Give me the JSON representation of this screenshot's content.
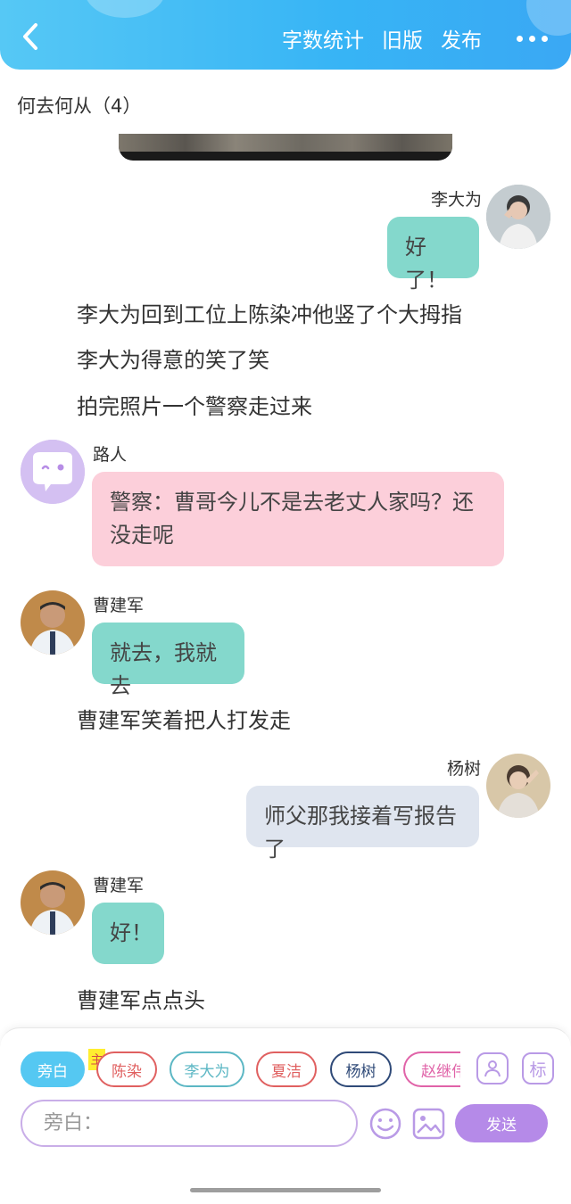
{
  "header": {
    "word_count": "字数统计",
    "old_version": "旧版",
    "publish": "发布",
    "back_icon": "chevron-left-icon",
    "more_icon": "more-dots-icon"
  },
  "chapter_title": "何去何从（4）",
  "messages": {
    "m1": {
      "name": "李大为",
      "text": "好了！"
    },
    "n1": "李大为回到工位上陈染冲他竖了个大拇指",
    "n2": "李大为得意的笑了笑",
    "n3": "拍完照片一个警察走过来",
    "m2": {
      "name": "路人",
      "text": "警察：曹哥今儿不是去老丈人家吗？还没走呢"
    },
    "m3": {
      "name": "曹建军",
      "text": "就去，我就去"
    },
    "n4": "曹建军笑着把人打发走",
    "m4": {
      "name": "杨树",
      "text": "师父那我接着写报告了"
    },
    "m5": {
      "name": "曹建军",
      "text": "好！"
    },
    "n5": "曹建军点点头"
  },
  "roles": {
    "narrator": "旁白",
    "main_tag": "主",
    "chen": "陈染",
    "li": "李大为",
    "xia": "夏洁",
    "yang": "杨树",
    "zhao": "赵继伟"
  },
  "tools": {
    "mark": "标"
  },
  "input": {
    "placeholder": "旁白："
  },
  "send": "发送",
  "colors": {
    "header": "#37b4f5",
    "teal_bubble": "#84d8cc",
    "pink_bubble": "#fccfda",
    "gray_bubble": "#dfe5ef",
    "accent_purple": "#b58ae8"
  }
}
